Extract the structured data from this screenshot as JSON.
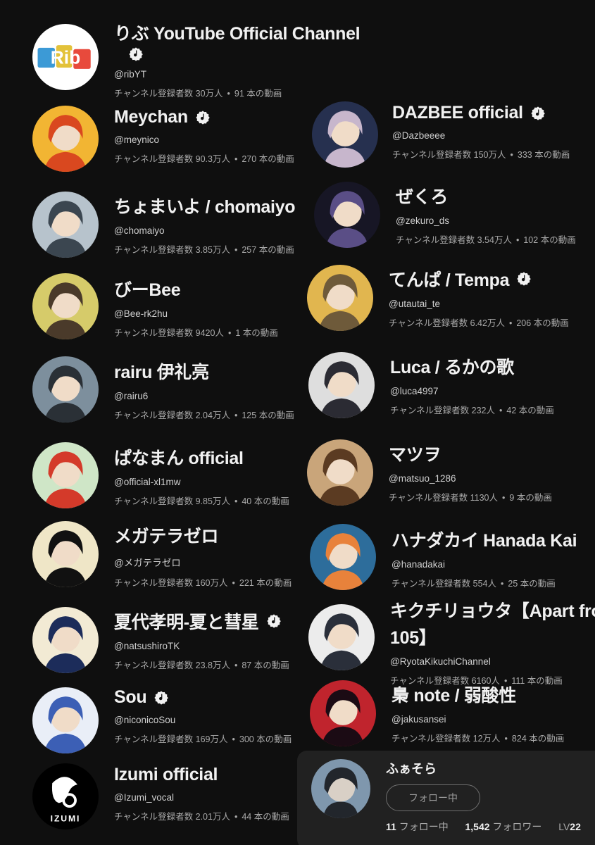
{
  "subscriber_prefix": "チャンネル登録者数",
  "sep": "•",
  "channels": [
    {
      "name": "りぶ YouTube Official Channel",
      "handle": "@ribYT",
      "subs": "30万人",
      "videos": "91 本の動画",
      "verified": true,
      "avatar_icon": "rib-logo-avatar",
      "colors": [
        "#ffffff",
        "#e84a3c"
      ]
    },
    {
      "name": "Meychan",
      "handle": "@meynico",
      "subs": "90.3万人",
      "videos": "270 本の動画",
      "verified": true,
      "avatar_icon": "anime-boy-orange-hair-avatar",
      "colors": [
        "#f2b533",
        "#d9481f"
      ]
    },
    {
      "name": "DAZBEE official",
      "handle": "@Dazbeeee",
      "subs": "150万人",
      "videos": "333 本の動画",
      "verified": true,
      "avatar_icon": "anime-girl-book-avatar",
      "colors": [
        "#26304f",
        "#c7b6cc"
      ]
    },
    {
      "name": "ちょまいよ / chomaiyo",
      "handle": "@chomaiyo",
      "subs": "3.85万人",
      "videos": "257 本の動画",
      "verified": false,
      "avatar_icon": "photo-person-cat-mask-avatar",
      "colors": [
        "#b7c3cc",
        "#3b4650"
      ]
    },
    {
      "name": "ぜくろ",
      "handle": "@zekuro_ds",
      "subs": "3.54万人",
      "videos": "102 本の動画",
      "verified": false,
      "avatar_icon": "anime-boy-dark-avatar",
      "colors": [
        "#171625",
        "#5a4e86"
      ]
    },
    {
      "name": "びーBee",
      "handle": "@Bee-rk2hu",
      "subs": "9420人",
      "videos": "1 本の動画",
      "verified": false,
      "avatar_icon": "anime-boy-yellow-avatar",
      "colors": [
        "#d6cb6a",
        "#4a3a2a"
      ]
    },
    {
      "name": "てんぱ / Tempa",
      "handle": "@utautai_te",
      "subs": "6.42万人",
      "videos": "206 本の動画",
      "verified": true,
      "avatar_icon": "anime-boy-sunset-avatar",
      "colors": [
        "#e1b64f",
        "#6e5a3a"
      ]
    },
    {
      "name": "rairu 伊礼亮",
      "handle": "@rairu6",
      "subs": "2.04万人",
      "videos": "125 本の動画",
      "verified": false,
      "avatar_icon": "photo-seaside-avatar",
      "colors": [
        "#7d8f9d",
        "#2a3036"
      ]
    },
    {
      "name": "Luca / るかの歌",
      "handle": "@luca4997",
      "subs": "232人",
      "videos": "42 本の動画",
      "verified": false,
      "avatar_icon": "anime-boy-flowers-avatar",
      "colors": [
        "#dedede",
        "#2b2b33"
      ]
    },
    {
      "name": "ぱなまん official",
      "handle": "@official-xl1mw",
      "subs": "9.85万人",
      "videos": "40 本の動画",
      "verified": false,
      "avatar_icon": "cartoon-boy-apple-avatar",
      "colors": [
        "#cfe6c7",
        "#d43a2a"
      ]
    },
    {
      "name": "マツヲ",
      "handle": "@matsuo_1286",
      "subs": "1130人",
      "videos": "9 本の動画",
      "verified": false,
      "avatar_icon": "anime-boy-brown-hair-avatar",
      "colors": [
        "#c9a57a",
        "#5b3b22"
      ]
    },
    {
      "name": "メガテラゼロ",
      "handle": "@メガテラゼロ",
      "subs": "160万人",
      "videos": "221 本の動画",
      "verified": false,
      "avatar_icon": "sketch-face-avatar",
      "colors": [
        "#efe6c7",
        "#111111"
      ]
    },
    {
      "name": "ハナダカイ Hanada Kai",
      "handle": "@hanadakai",
      "subs": "554人",
      "videos": "25 本の動画",
      "verified": false,
      "avatar_icon": "blue-goldfish-avatar",
      "colors": [
        "#2d6d9b",
        "#e8823b"
      ]
    },
    {
      "name": "夏代孝明-夏と彗星",
      "handle": "@natsushiroTK",
      "subs": "23.8万人",
      "videos": "87 本の動画",
      "verified": true,
      "avatar_icon": "anime-boy-navy-avatar",
      "colors": [
        "#f2ead4",
        "#1c2c5a"
      ]
    },
    {
      "name": "キクチリョウタ【Apart from",
      "name2": "105】",
      "handle": "@RyotaKikuchiChannel",
      "subs": "6160人",
      "videos": "111 本の動画",
      "verified": false,
      "avatar_icon": "photo-man-white-wall-avatar",
      "colors": [
        "#ececec",
        "#2a2f3a"
      ]
    },
    {
      "name": "Sou",
      "handle": "@niconicoSou",
      "subs": "169万人",
      "videos": "300 本の動画",
      "verified": true,
      "avatar_icon": "anime-headphones-avatar",
      "colors": [
        "#e9eef7",
        "#3c5fb5"
      ]
    },
    {
      "name": "梟 note / 弱酸性",
      "handle": "@jakusansei",
      "subs": "12万人",
      "videos": "824 本の動画",
      "verified": false,
      "avatar_icon": "photo-red-light-avatar",
      "colors": [
        "#c0242d",
        "#1b0b14"
      ]
    },
    {
      "name": "Izumi official",
      "handle": "@Izumi_vocal",
      "subs": "2.01万人",
      "videos": "44 本の動画",
      "verified": false,
      "avatar_icon": "izumi-logo-avatar",
      "colors": [
        "#000000",
        "#ffffff"
      ]
    }
  ],
  "avatar_logo_texts": {
    "rib": "Rib",
    "izumi": "IZUMI"
  },
  "popup": {
    "name": "ふぁそら",
    "follow_label": "フォロー中",
    "following_count": "11",
    "following_label": "フォロー中",
    "followers_count": "1,542",
    "followers_label": "フォロワー",
    "level_prefix": "LV",
    "level": "22",
    "avatar_icon": "anime-boy-blue-avatar",
    "colors": [
      "#7f97ad",
      "#22262c"
    ]
  }
}
